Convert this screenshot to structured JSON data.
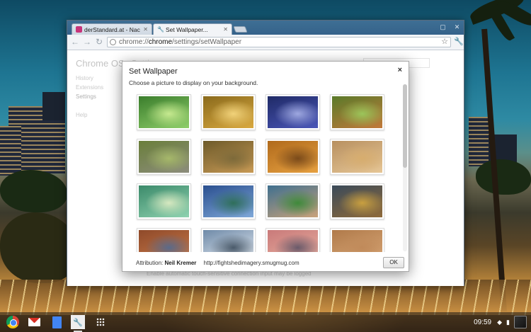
{
  "browser": {
    "tabs": [
      {
        "label": "derStandard.at - Nachrict",
        "favicon": "derstandard-favicon",
        "favicon_color": "#c8347a",
        "active": false
      },
      {
        "label": "Set Wallpaper...",
        "favicon": "wrench-favicon",
        "favicon_color": "#555555",
        "active": true
      }
    ],
    "url_prefix": "chrome://",
    "url_host": "chrome",
    "url_path": "/settings/setWallpaper"
  },
  "settings_page": {
    "brand": "Chrome OS",
    "title": "Settings",
    "nav": [
      "History",
      "Extensions",
      "Settings",
      "",
      "Help"
    ],
    "footnote": "Enable automatic touch-sensitive connection input may be logged"
  },
  "dialog": {
    "title": "Set Wallpaper",
    "close_label": "×",
    "subtitle": "Choose a picture to display on your background.",
    "attribution_label": "Attribution:",
    "attribution_name": "Neil Kremer",
    "attribution_url": "http://fightshedimagery.smugmug.com",
    "ok_label": "OK",
    "wallpapers": [
      {
        "name": "green-grass-blades",
        "colors": [
          "#3a7d2c",
          "#8fce6a",
          "#c6e98f"
        ]
      },
      {
        "name": "golden-grass-butterfly",
        "colors": [
          "#8a6a1c",
          "#d9a940",
          "#f1d27a"
        ]
      },
      {
        "name": "blue-mushrooms",
        "colors": [
          "#1f2a66",
          "#4a56b8",
          "#9ea8e0"
        ]
      },
      {
        "name": "fox-on-grass",
        "colors": [
          "#5a7a2a",
          "#c2793a",
          "#9bc55a"
        ]
      },
      {
        "name": "baby-elephant",
        "colors": [
          "#6a7f3a",
          "#8c8c7c",
          "#a6b86a"
        ]
      },
      {
        "name": "owl-in-flight",
        "colors": [
          "#6d5a2a",
          "#c89a55",
          "#7d6a3a"
        ]
      },
      {
        "name": "small-bird-on-branch",
        "colors": [
          "#b06a1c",
          "#e6a040",
          "#7a4a1a"
        ]
      },
      {
        "name": "mouse-in-straw",
        "colors": [
          "#b89060",
          "#e6c696",
          "#d7ad6e"
        ]
      },
      {
        "name": "green-sand-dunes",
        "colors": [
          "#3b8a6a",
          "#8fd2b0",
          "#d6e8c0"
        ]
      },
      {
        "name": "mountain-lake",
        "colors": [
          "#2a4f8f",
          "#7fa8d8",
          "#2f6f5a"
        ]
      },
      {
        "name": "green-rock-beach",
        "colors": [
          "#3f6f8f",
          "#c9a27a",
          "#3f8a3a"
        ]
      },
      {
        "name": "autumn-valley-storm",
        "colors": [
          "#3a4a5a",
          "#8f6a3a",
          "#c9a040"
        ]
      },
      {
        "name": "red-canyon",
        "colors": [
          "#8f4a2a",
          "#c97a4a",
          "#5a6a8a"
        ]
      },
      {
        "name": "snowy-peaks",
        "colors": [
          "#6f8aa8",
          "#e8eef4",
          "#4a5a6a"
        ]
      },
      {
        "name": "pink-sunset-mountains",
        "colors": [
          "#c97a7a",
          "#e8b0a0",
          "#6a5a6a"
        ]
      },
      {
        "name": "sand-ripples",
        "colors": [
          "#b07a4a",
          "#d9a878",
          "#c08a5a"
        ]
      }
    ],
    "scroll_position": 0.0,
    "scroll_visible_fraction": 0.5
  },
  "shelf": {
    "apps": [
      {
        "name": "chrome-app",
        "icon": "chrome-icon"
      },
      {
        "name": "gmail-app",
        "icon": "gmail-icon"
      },
      {
        "name": "docs-app",
        "icon": "docs-icon"
      },
      {
        "name": "settings-app",
        "icon": "wrench-icon",
        "active": true
      },
      {
        "name": "app-launcher",
        "icon": "apps-grid-icon"
      }
    ],
    "clock": "09:59",
    "wifi_icon": "wifi-icon",
    "battery_icon": "battery-icon"
  }
}
